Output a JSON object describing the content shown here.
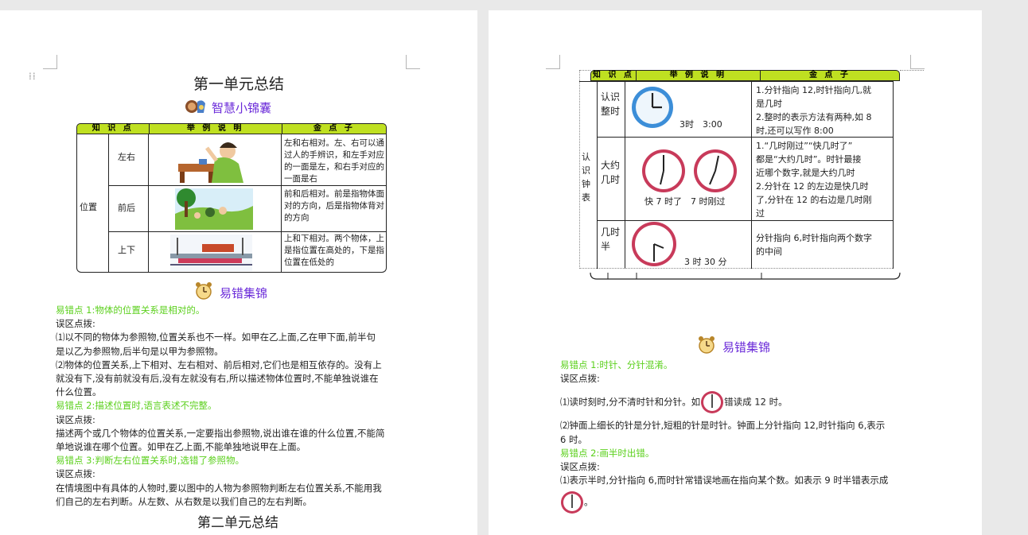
{
  "page1": {
    "title": "第一单元总结",
    "section1": "智慧小锦囊",
    "table": {
      "headers": [
        "知 识 点",
        "举 例 说 明",
        "金 点 子"
      ],
      "category": "位置",
      "rows": [
        {
          "label": "左右",
          "scene": "desk-scene",
          "text": "左和右相对。左、右可以通过人的手辨识，和左手对应的一面是左，和右手对应的一面是右"
        },
        {
          "label": "前后",
          "scene": "park-scene",
          "text": "前和后相对。前是指物体面对的方向，后是指物体背对的方向"
        },
        {
          "label": "上下",
          "scene": "bridge-scene",
          "text": "上和下相对。两个物体，上是指位置在高处的，下是指位置在低处的"
        }
      ]
    },
    "section2": "易错集锦",
    "lines": [
      {
        "t": "易错点 1:物体的位置关系是相对的。",
        "g": true
      },
      {
        "t": "误区点拨:",
        "g": false
      },
      {
        "t": "⑴以不同的物体为参照物,位置关系也不一样。如甲在乙上面,乙在甲下面,前半句",
        "g": false
      },
      {
        "t": "是以乙为参照物,后半句是以甲为参照物。",
        "g": false
      },
      {
        "t": "⑵物体的位置关系,上下相对、左右相对、前后相对,它们也是相互依存的。没有上",
        "g": false
      },
      {
        "t": "就没有下,没有前就没有后,没有左就没有右,所以描述物体位置时,不能单独说谁在",
        "g": false
      },
      {
        "t": "什么位置。",
        "g": false
      },
      {
        "t": "易错点 2:描述位置时,语言表述不完整。",
        "g": true
      },
      {
        "t": "误区点拨:",
        "g": false
      },
      {
        "t": "描述两个或几个物体的位置关系,一定要指出参照物,说出谁在谁的什么位置,不能简",
        "g": false
      },
      {
        "t": "单地说谁在哪个位置。如甲在乙上面,不能单独地说甲在上面。",
        "g": false
      },
      {
        "t": "易错点 3:判断左右位置关系时,选错了参照物。",
        "g": true
      },
      {
        "t": "误区点拨:",
        "g": false
      },
      {
        "t": "在情境图中有具体的人物时,要以图中的人物为参照物判断左右位置关系,不能用我",
        "g": false
      },
      {
        "t": "们自己的左右判断。从左数、从右数是以我们自己的左右判断。",
        "g": false
      }
    ],
    "next_title": "第二单元总结"
  },
  "page2": {
    "table": {
      "headers": [
        "知 识 点",
        "举 例 说 明",
        "金 点 子"
      ],
      "category": "认识钟表",
      "rows": [
        {
          "label": "认识整时",
          "caption": "3时　3:00",
          "tips": [
            "1.分针指向 12,时针指向几,就",
            "是几时",
            "2.整时的表示方法有两种,如 8",
            "时,还可以写作 8:00"
          ]
        },
        {
          "label": "大约几时",
          "caption": "快 7 时了　7 时刚过",
          "tips": [
            "1.“几时刚过”“快几时了”",
            "都是“大约几时”。时针最接",
            "近哪个数字,就是大约几时",
            "2.分针在 12 的左边是快几时",
            "了,分针在 12 的右边是几时刚",
            "过"
          ]
        },
        {
          "label": "几时半",
          "caption": "3 时 30 分",
          "tips": [
            "分针指向 6,时针指向两个数字",
            "的中间"
          ]
        }
      ]
    },
    "section": "易错集锦",
    "lines": [
      {
        "t": "易错点 1:时针、分针混淆。",
        "g": true
      },
      {
        "t": "误区点拨:",
        "g": false
      },
      {
        "t": "⑴读时刻时,分不清时针和分针。如",
        "g": false,
        "clock": true,
        "after": "错读成 12 时。"
      },
      {
        "t": "⑵钟面上细长的针是分针,短粗的针是时针。钟面上分针指向 12,时针指向 6,表示",
        "g": false
      },
      {
        "t": "6 时。",
        "g": false
      },
      {
        "t": "易错点 2:画半时出错。",
        "g": true
      },
      {
        "t": "误区点拨:",
        "g": false
      },
      {
        "t": "⑴表示半时,分针指向 6,而时针常错误地画在指向某个数。如表示 9 时半错表示成",
        "g": false
      }
    ],
    "last_after": "。"
  },
  "colors": {
    "accent": "#6b2bd9",
    "tip": "#5bd01c",
    "header": "#bfe021",
    "clock_rim": "#c83a5a",
    "blue_clock": "#3c8ed8"
  }
}
